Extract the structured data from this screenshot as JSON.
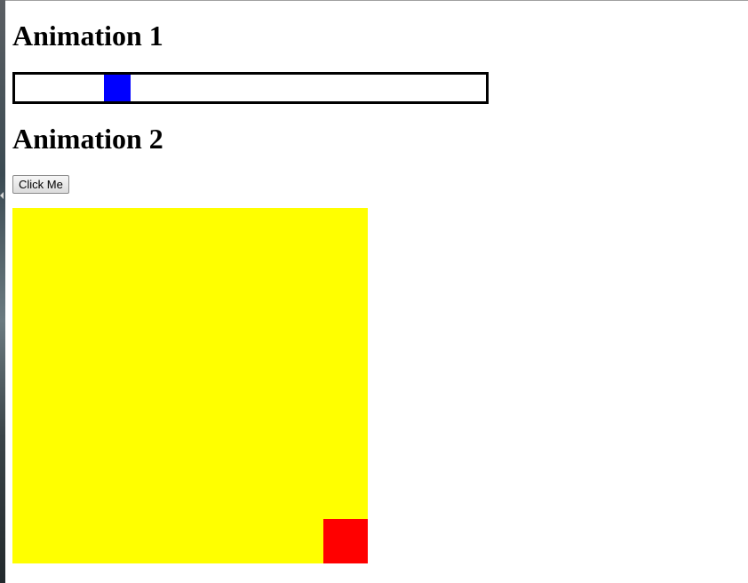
{
  "sections": {
    "animation1": {
      "heading": "Animation 1",
      "slider_progress": 0.2
    },
    "animation2": {
      "heading": "Animation 2",
      "button_label": "Click Me",
      "box_progress": 1.0
    }
  },
  "colors": {
    "slider_block": "#0000ff",
    "container": "#ffff00",
    "moving_box": "#ff0000",
    "track_border": "#000000"
  }
}
